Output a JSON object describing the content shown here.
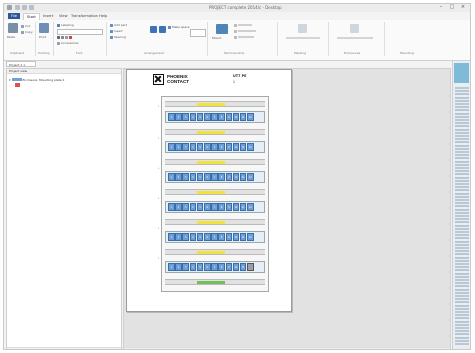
{
  "window": {
    "title": "PROJECT complete 2014/c - Desktop"
  },
  "menu": {
    "tabs": [
      "File",
      "Start",
      "Insert",
      "View",
      "Transformation",
      "Help"
    ]
  },
  "ribbon": {
    "groups": [
      "Clipboard",
      "Printing",
      "Font",
      "Arrangement",
      "Terminal strip",
      "Marking",
      "Enclosures",
      "Mounting"
    ],
    "buttons": {
      "paste": "Paste",
      "cut": "Cut",
      "copy": "Copy",
      "print": "Print",
      "labeling": "Labeling",
      "accessories": "Accessories",
      "add_part": "Add part",
      "insert": "Insert",
      "spacing": "Spacing",
      "make_space": "Make space",
      "mount": "Mount"
    }
  },
  "document_tab": {
    "label": "Project 1 ×"
  },
  "tree": {
    "header": "Project view",
    "root_label": "Enclosure: Mounting plate 1"
  },
  "sheet": {
    "logo_text": "PHOENIX\nCONTACT",
    "part_number": "UT7 PE",
    "quantity": "1",
    "terminal_numbers": [
      "1",
      "2",
      "3",
      "4",
      "5",
      "6",
      "7",
      "8",
      "9",
      "10",
      "11",
      "12"
    ]
  },
  "colors": {
    "terminal_blue": "#6d9fd7",
    "marker_yellow": "#f2e33c",
    "marker_green": "#74c05a",
    "file_tab": "#2b5796"
  }
}
